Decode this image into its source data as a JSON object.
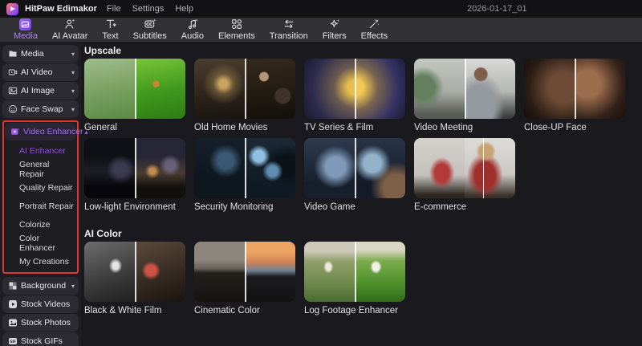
{
  "titlebar": {
    "app_name": "HitPaw Edimakor",
    "menus": [
      {
        "label": "File"
      },
      {
        "label": "Settings"
      },
      {
        "label": "Help"
      }
    ],
    "document_title": "2026-01-17_01"
  },
  "toolbar": {
    "tabs": [
      {
        "label": "Media",
        "icon": "media-icon",
        "active": true
      },
      {
        "label": "AI Avatar",
        "icon": "avatar-icon",
        "active": false
      },
      {
        "label": "Text",
        "icon": "text-icon",
        "active": false
      },
      {
        "label": "Subtitles",
        "icon": "subtitles-icon",
        "active": false
      },
      {
        "label": "Audio",
        "icon": "audio-icon",
        "active": false
      },
      {
        "label": "Elements",
        "icon": "elements-icon",
        "active": false
      },
      {
        "label": "Transition",
        "icon": "transition-icon",
        "active": false
      },
      {
        "label": "Filters",
        "icon": "filters-icon",
        "active": false
      },
      {
        "label": "Effects",
        "icon": "effects-icon",
        "active": false
      }
    ]
  },
  "sidebar": {
    "items": [
      {
        "label": "Media",
        "icon": "folder-icon",
        "chevron": "down"
      },
      {
        "label": "AI Video",
        "icon": "video-camera-icon",
        "chevron": "down"
      },
      {
        "label": "AI Image",
        "icon": "image-icon",
        "chevron": "down"
      },
      {
        "label": "Face Swap",
        "icon": "face-icon",
        "chevron": "down"
      }
    ],
    "enhancer": {
      "label": "Video Enhancer",
      "icon": "video-enhancer-icon",
      "chevron": "up",
      "active": true,
      "highlighted": true
    },
    "enhancer_subitems": [
      {
        "label": "AI Enhancer",
        "active": true
      },
      {
        "label": "General Repair",
        "active": false
      },
      {
        "label": "Quality Repair",
        "active": false
      },
      {
        "label": "Portrait Repair",
        "active": false
      },
      {
        "label": "Colorize",
        "active": false
      },
      {
        "label": "Color Enhancer",
        "active": false
      },
      {
        "label": "My Creations",
        "active": false
      }
    ],
    "bottom_items": [
      {
        "label": "Background",
        "icon": "checkerboard-icon",
        "chevron": "down"
      },
      {
        "label": "Stock Videos",
        "icon": "play-circle-icon",
        "chevron": ""
      },
      {
        "label": "Stock Photos",
        "icon": "photo-icon",
        "chevron": ""
      },
      {
        "label": "Stock GIFs",
        "icon": "gif-icon",
        "chevron": ""
      }
    ]
  },
  "content": {
    "sections": [
      {
        "title": "Upscale",
        "cards": [
          {
            "label": "General"
          },
          {
            "label": "Old Home Movies"
          },
          {
            "label": "TV Series & Film"
          },
          {
            "label": "Video Meeting"
          },
          {
            "label": "Close-UP Face"
          },
          {
            "label": "Low-light Environment"
          },
          {
            "label": "Security Monitoring"
          },
          {
            "label": "Video Game"
          },
          {
            "label": "E-commerce"
          }
        ]
      },
      {
        "title": "AI Color",
        "cards": [
          {
            "label": "Black & White Film"
          },
          {
            "label": "Cinematic Color"
          },
          {
            "label": "Log Footage Enhancer"
          }
        ]
      }
    ]
  },
  "colors": {
    "accent_purple": "#9c5cf0",
    "highlight_red": "#e13632",
    "toolbar_bg": "#323236",
    "content_bg": "#19191e"
  }
}
